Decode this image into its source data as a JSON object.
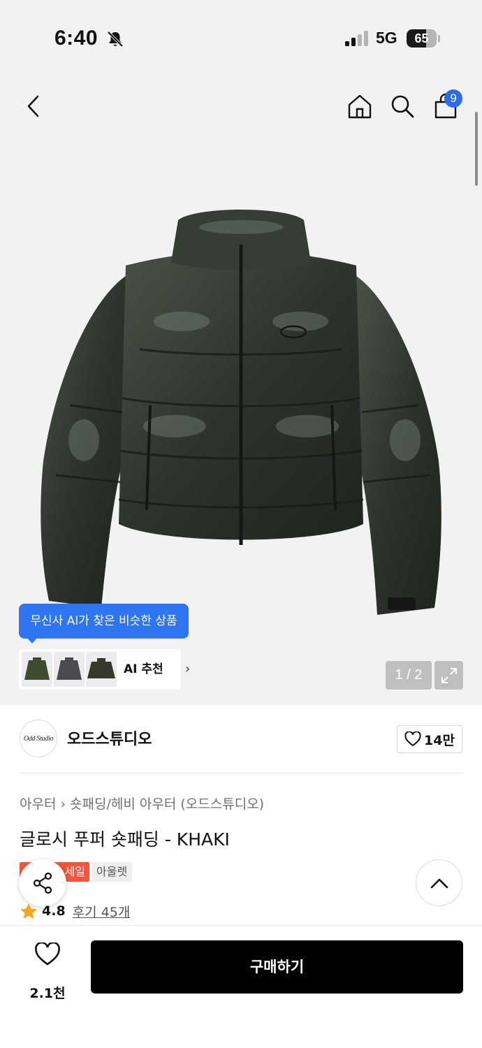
{
  "status_bar": {
    "time": "6:40",
    "network": "5G",
    "battery_percent": "65"
  },
  "nav": {
    "cart_count": "9"
  },
  "gallery": {
    "ai_tooltip": "무신사 AI가 찾은 비슷한 상품",
    "ai_strip_label": "AI 추천",
    "page_indicator": "1 / 2"
  },
  "brand": {
    "logo_text": "Odd Studio",
    "name": "오드스튜디오",
    "likes": "14만"
  },
  "breadcrumb": [
    "아우터",
    "숏패딩/헤비 아우터 (오드스튜디오)"
  ],
  "product": {
    "title": "글로시 푸퍼 숏패딩 - KHAKI",
    "badge_sale": "세일",
    "badge_outlet": "아울렛",
    "rating": "4.8",
    "reviews": "후기 45개"
  },
  "bottom_bar": {
    "wish_count": "2.1천",
    "buy_label": "구매하기"
  },
  "colors": {
    "accent_blue": "#2f74f2",
    "sale_red": "#f4553a",
    "buy_black": "#000000",
    "star": "#f5a623"
  }
}
